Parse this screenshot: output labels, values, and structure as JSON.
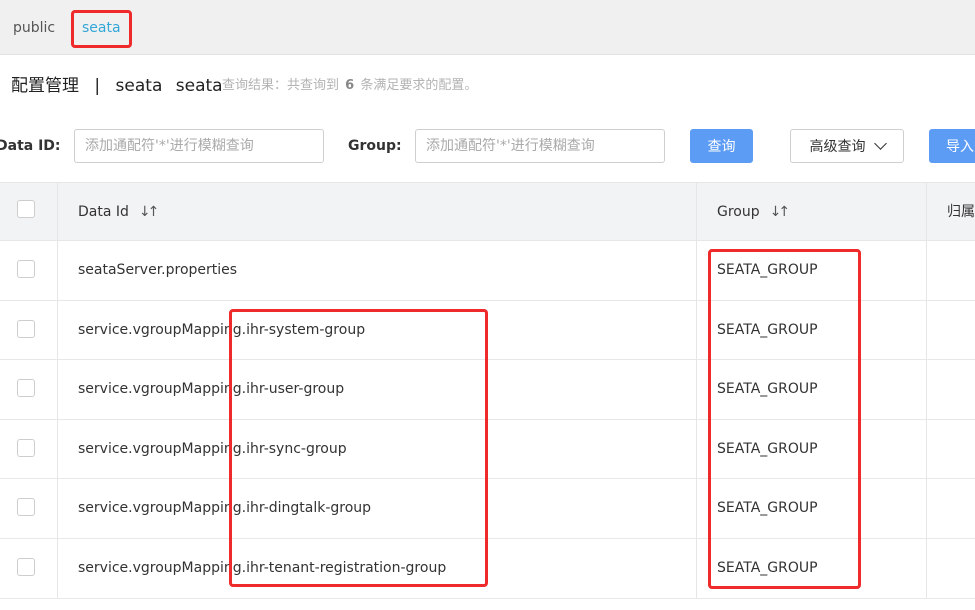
{
  "namespace_tabs": [
    {
      "label": "public"
    },
    {
      "label": "seata",
      "active": true
    }
  ],
  "header": {
    "title": "配置管理",
    "separator": "|",
    "namespace_name": "seata",
    "namespace_id": "seata",
    "result_prefix": "查询结果：共查询到",
    "result_count": "6",
    "result_suffix": "条满足要求的配置。"
  },
  "search": {
    "data_id_label": "Data ID:",
    "data_id_placeholder": "添加通配符'*'进行模糊查询",
    "group_label": "Group:",
    "group_placeholder": "添加通配符'*'进行模糊查询",
    "query_button": "查询",
    "advanced_button": "高级查询",
    "import_button": "导入"
  },
  "table": {
    "columns": [
      "Data Id",
      "Group",
      "归属"
    ],
    "rows": [
      {
        "data_id": "seataServer.properties",
        "group": "SEATA_GROUP"
      },
      {
        "data_id": "service.vgroupMapping.ihr-system-group",
        "group": "SEATA_GROUP"
      },
      {
        "data_id": "service.vgroupMapping.ihr-user-group",
        "group": "SEATA_GROUP"
      },
      {
        "data_id": "service.vgroupMapping.ihr-sync-group",
        "group": "SEATA_GROUP"
      },
      {
        "data_id": "service.vgroupMapping.ihr-dingtalk-group",
        "group": "SEATA_GROUP"
      },
      {
        "data_id": "service.vgroupMapping.ihr-tenant-registration-group",
        "group": "SEATA_GROUP"
      }
    ]
  },
  "colors": {
    "accent": "#5d9cf5",
    "active_tab": "#33a7d8",
    "highlight": "#ee2a2a"
  }
}
